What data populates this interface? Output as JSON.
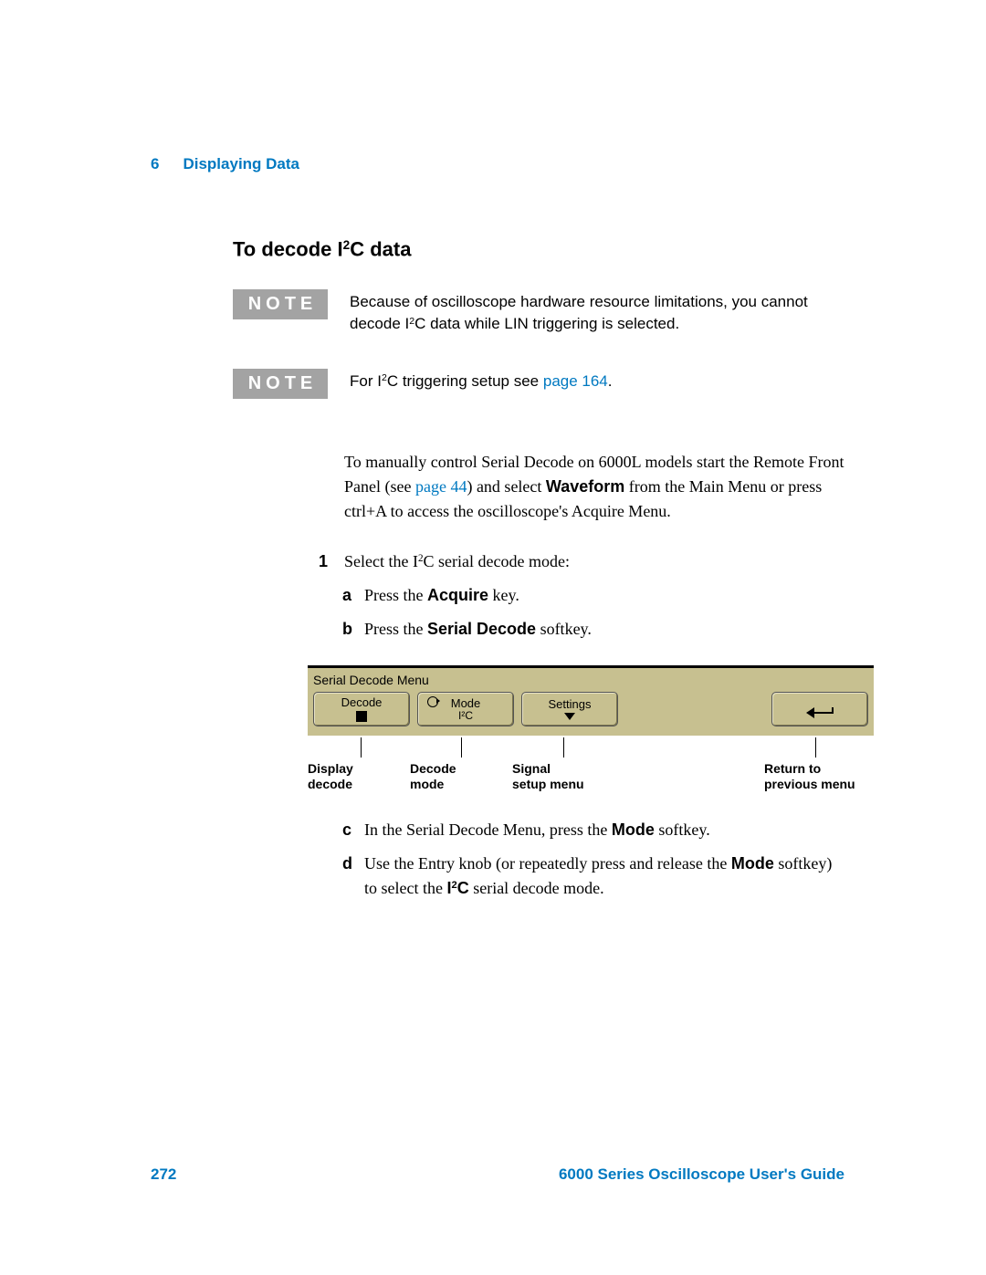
{
  "header": {
    "chapter_number": "6",
    "chapter_title": "Displaying Data"
  },
  "heading": {
    "pre": "To decode I",
    "sup": "2",
    "post": "C data"
  },
  "notes": [
    {
      "label": "NOTE",
      "text_parts": {
        "p1": "Because of oscilloscope hardware resource limitations, you cannot decode I",
        "sup": "2",
        "p2": "C data while LIN triggering is selected."
      }
    },
    {
      "label": "NOTE",
      "text_parts": {
        "p1": "For I",
        "sup": "2",
        "p2": "C triggering setup see ",
        "link": "page 164",
        "p3": "."
      }
    }
  ],
  "paragraph": {
    "p1": "To manually control Serial Decode on 6000L models start the Remote Front Panel (see ",
    "link": "page 44",
    "p2": ") and select ",
    "bold1": "Waveform",
    "p3": " from the Main Menu or press ctrl+A to access the oscilloscope's Acquire Menu."
  },
  "steps": {
    "num1": "1",
    "step1_pre": "Select the I",
    "step1_sup": "2",
    "step1_post": "C serial decode mode:",
    "sub": {
      "a": {
        "num": "a",
        "pre": "Press the ",
        "bold": "Acquire",
        "post": " key."
      },
      "b": {
        "num": "b",
        "pre": "Press the ",
        "bold": "Serial Decode",
        "post": " softkey."
      },
      "c": {
        "num": "c",
        "pre": "In the Serial Decode Menu, press the ",
        "bold": "Mode",
        "post": " softkey."
      },
      "d": {
        "num": "d",
        "pre": "Use the Entry knob (or repeatedly press and release the ",
        "bold1": "Mode",
        "mid": " softkey) to select the ",
        "bold2_pre": "I",
        "bold2_sup": "2",
        "bold2_post": "C",
        "post": " serial decode mode."
      }
    }
  },
  "menu": {
    "title": "Serial Decode Menu",
    "softkeys": {
      "k1": {
        "label": "Decode"
      },
      "k2": {
        "label": "Mode",
        "value": "I²C"
      },
      "k3": {
        "label": "Settings"
      }
    },
    "callouts": {
      "c1a": "Display",
      "c1b": "decode",
      "c2a": "Decode",
      "c2b": "mode",
      "c3a": "Signal",
      "c3b": "setup menu",
      "c4a": "Return to",
      "c4b": "previous menu"
    }
  },
  "footer": {
    "page_number": "272",
    "doc_title": "6000 Series Oscilloscope User's Guide"
  }
}
